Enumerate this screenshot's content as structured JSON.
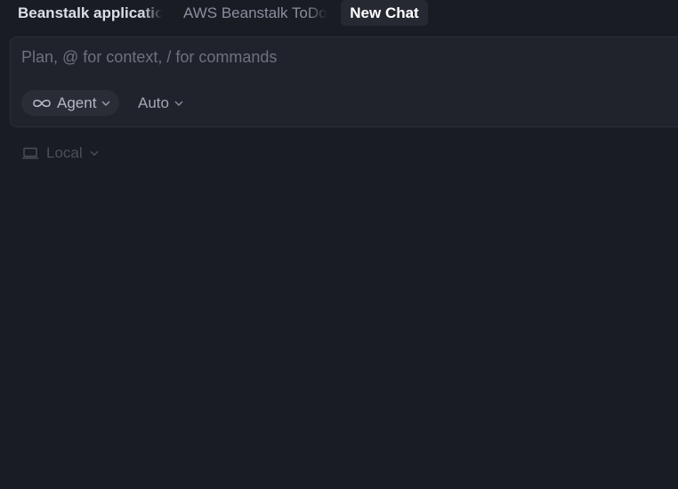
{
  "tabs": [
    {
      "label": "Beanstalk application",
      "active": false
    },
    {
      "label": "AWS Beanstalk ToDo",
      "active": false
    },
    {
      "label": "New Chat",
      "active": true
    }
  ],
  "composer": {
    "placeholder": "Plan, @ for context, / for commands",
    "mode": {
      "icon": "infinity-icon",
      "label": "Agent"
    },
    "model": {
      "label": "Auto"
    }
  },
  "environment": {
    "icon": "laptop-icon",
    "label": "Local"
  },
  "colors": {
    "background": "#1a1c24",
    "composer_bg": "#20232b",
    "active_tab_bg": "#262932"
  }
}
